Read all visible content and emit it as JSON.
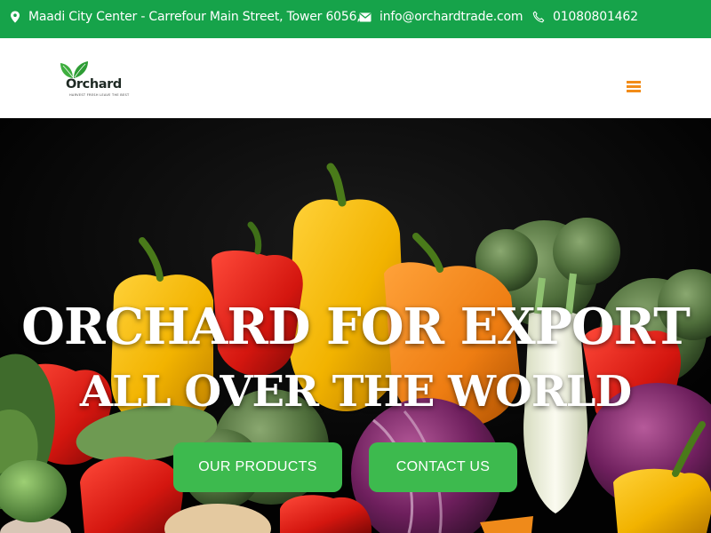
{
  "topbar": {
    "address": "Maadi City Center - Carrefour Main Street, Tower 6056,",
    "email": "info@orchardtrade.com",
    "phone": "01080801462",
    "address_icon": "map-pin-icon",
    "email_icon": "envelope-icon",
    "phone_icon": "phone-icon"
  },
  "header": {
    "logo_text": "Orchard",
    "logo_tagline": "HARVEST FRESH LEAVE THE BEST",
    "menu_icon": "hamburger-menu-icon"
  },
  "hero": {
    "title_line1": "ORCHARD FOR EXPORT",
    "title_line2": "ALL OVER THE WORLD",
    "button_products": "OUR PRODUCTS",
    "button_contact": "CONTACT US"
  },
  "colors": {
    "brand_green": "#16a34a",
    "button_green": "#3dba4e",
    "menu_orange": "#f28c18"
  }
}
